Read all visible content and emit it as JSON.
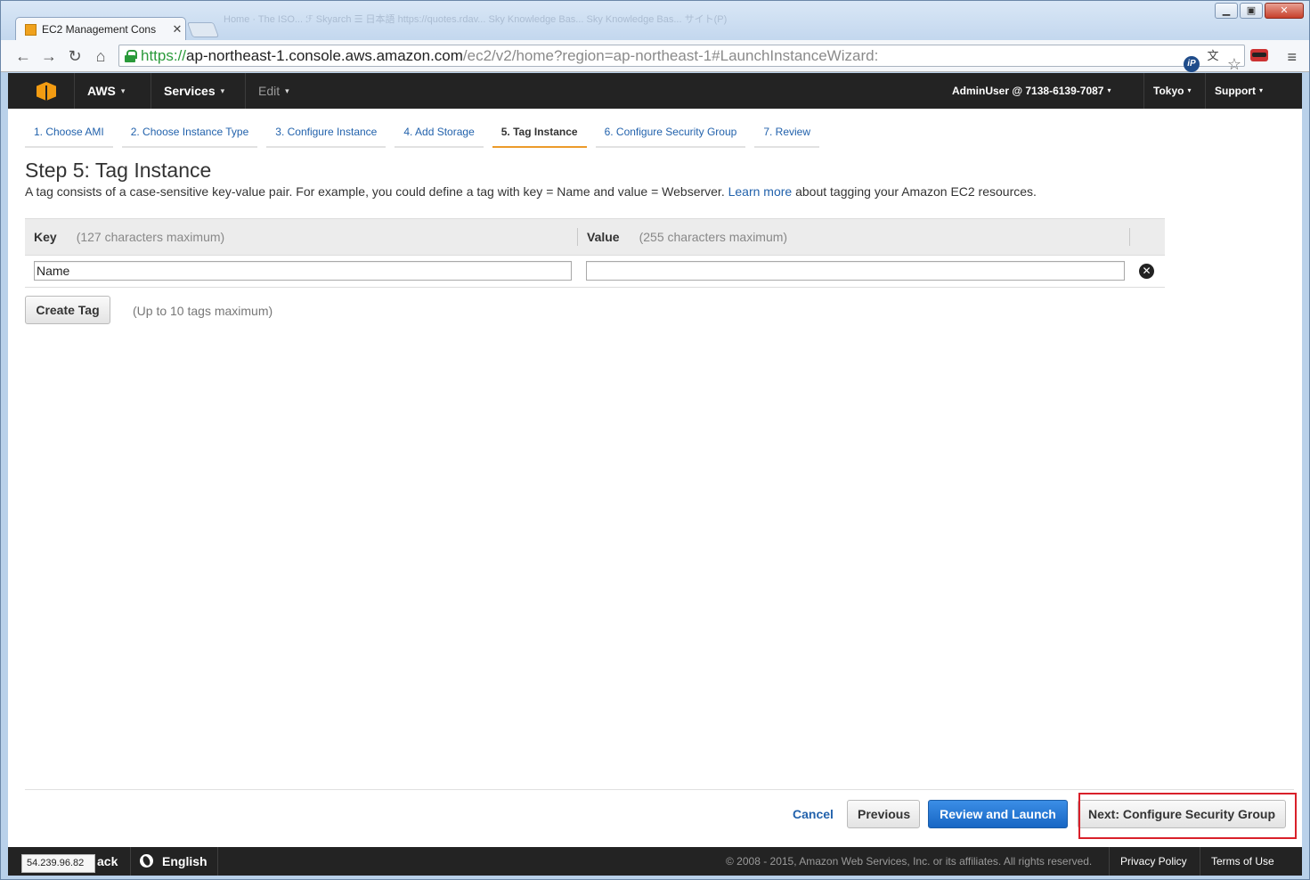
{
  "browser": {
    "tab_title": "EC2 Management Cons",
    "tab_close": "✕",
    "background_tabs": "Home · The ISO...   ℱ Skyarch   ☰ 日本語   https://quotes.rdav...   Sky Knowledge Bas...   Sky Knowledge Bas...   サイト(P)",
    "url": {
      "scheme": "https://",
      "host": "ap-northeast-1.console.aws.amazon.com",
      "path": "/ec2/v2/home?region=ap-northeast-1#LaunchInstanceWizard:"
    },
    "window_buttons": {
      "minimize": "▁",
      "restore": "▣",
      "close": "✕"
    },
    "nav": {
      "back": "←",
      "forward": "→",
      "reload": "↻",
      "home": "⌂"
    },
    "extensions": {
      "ip": "iP",
      "translate": "文",
      "star": "☆",
      "menu": "≡"
    }
  },
  "aws_nav": {
    "brand": "AWS",
    "services": "Services",
    "edit": "Edit",
    "account": "AdminUser @ 7138-6139-7087",
    "region": "Tokyo",
    "support": "Support",
    "caret": "▾"
  },
  "wizard": {
    "steps": [
      {
        "label": "1. Choose AMI",
        "active": false
      },
      {
        "label": "2. Choose Instance Type",
        "active": false
      },
      {
        "label": "3. Configure Instance",
        "active": false
      },
      {
        "label": "4. Add Storage",
        "active": false
      },
      {
        "label": "5. Tag Instance",
        "active": true
      },
      {
        "label": "6. Configure Security Group",
        "active": false
      },
      {
        "label": "7. Review",
        "active": false
      }
    ],
    "title": "Step 5: Tag Instance",
    "description_before": "A tag consists of a case-sensitive key-value pair. For example, you could define a tag with key = Name and value = Webserver.",
    "learn_more": "Learn more",
    "description_after": "about tagging your Amazon EC2 resources."
  },
  "tag_table": {
    "key_header": "Key",
    "key_hint": "(127 characters maximum)",
    "value_header": "Value",
    "value_hint": "(255 characters maximum)",
    "rows": [
      {
        "key": "Name",
        "value": ""
      }
    ],
    "remove_symbol": "✕"
  },
  "create_tag": {
    "label": "Create Tag",
    "hint": "(Up to 10 tags maximum)"
  },
  "actions": {
    "cancel": "Cancel",
    "previous": "Previous",
    "review_launch": "Review and Launch",
    "next": "Next: Configure Security Group"
  },
  "footer": {
    "feedback_partial": "ack",
    "language": "English",
    "copyright": "© 2008 - 2015, Amazon Web Services, Inc. or its affiliates. All rights reserved.",
    "privacy": "Privacy Policy",
    "terms": "Terms of Use",
    "status_ip": "54.239.96.82"
  },
  "colors": {
    "accent_link": "#2262ac",
    "active_step": "#ec9b2a",
    "primary_button": "#1766c4",
    "highlight": "#d9202a"
  }
}
